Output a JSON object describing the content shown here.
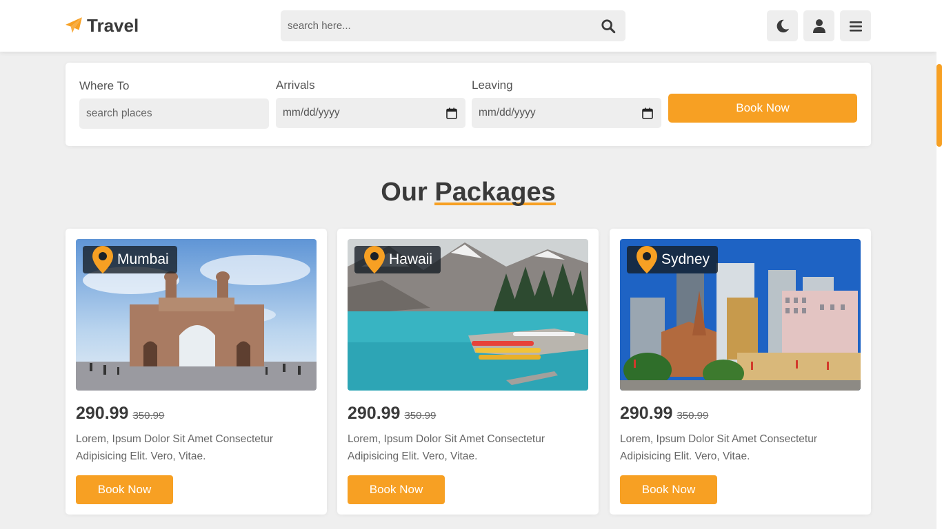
{
  "brand": {
    "name": "Travel",
    "accent_color": "#f7a023"
  },
  "search": {
    "placeholder": "search here..."
  },
  "header_buttons": [
    "moon-icon",
    "user-icon",
    "menu-icon"
  ],
  "booking": {
    "where_label": "Where To",
    "where_placeholder": "search places",
    "arrivals_label": "Arrivals",
    "arrivals_value": "mm/dd/yyyy",
    "leaving_label": "Leaving",
    "leaving_value": "mm/dd/yyyy",
    "button": "Book Now"
  },
  "section": {
    "title_plain": "Our",
    "title_accent": "Packages"
  },
  "packages": [
    {
      "place": "Mumbai",
      "price": "290.99",
      "old_price": "350.99",
      "description": "Lorem, Ipsum Dolor Sit Amet Consectetur Adipisicing Elit. Vero, Vitae.",
      "button": "Book Now"
    },
    {
      "place": "Hawaii",
      "price": "290.99",
      "old_price": "350.99",
      "description": "Lorem, Ipsum Dolor Sit Amet Consectetur Adipisicing Elit. Vero, Vitae.",
      "button": "Book Now"
    },
    {
      "place": "Sydney",
      "price": "290.99",
      "old_price": "350.99",
      "description": "Lorem, Ipsum Dolor Sit Amet Consectetur Adipisicing Elit. Vero, Vitae.",
      "button": "Book Now"
    }
  ]
}
